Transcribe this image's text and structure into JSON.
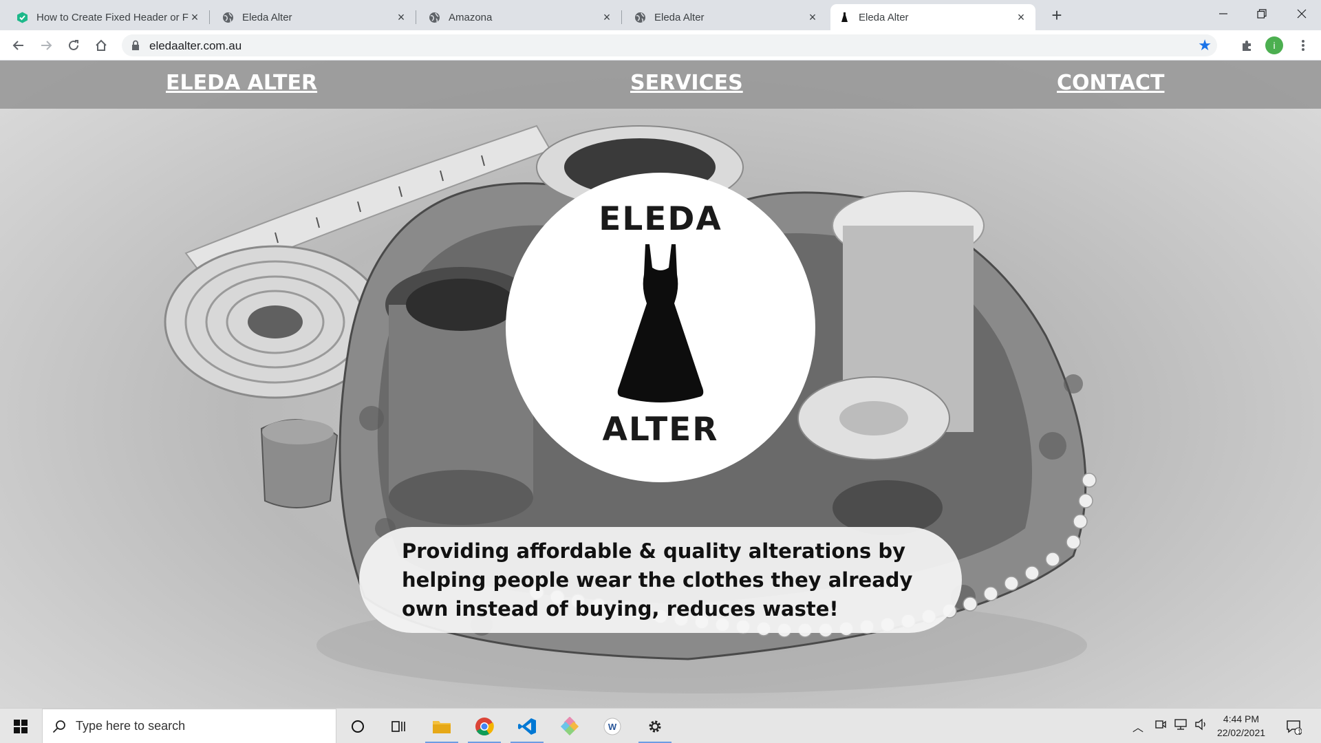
{
  "browser": {
    "tabs": [
      {
        "title": "How to Create Fixed Header or F",
        "favicon": "green-hex-icon",
        "active": false
      },
      {
        "title": "Eleda Alter",
        "favicon": "globe-icon",
        "active": false
      },
      {
        "title": "Amazona",
        "favicon": "globe-icon",
        "active": false
      },
      {
        "title": "Eleda Alter",
        "favicon": "globe-icon",
        "active": false
      },
      {
        "title": "Eleda Alter",
        "favicon": "dress-icon",
        "active": true
      }
    ],
    "url": "eledaalter.com.au",
    "profile_initial": "i",
    "accent_color": "#1a73e8"
  },
  "site": {
    "nav": {
      "brand": "ELEDA ALTER",
      "services": "SERVICES",
      "contact": "CONTACT"
    },
    "logo": {
      "line1": "ELEDA",
      "line2": "ALTER"
    },
    "tagline": "Providing affordable & quality alterations by helping people wear the clothes they already own instead of buying, reduces waste!"
  },
  "taskbar": {
    "search_placeholder": "Type here to search",
    "time": "4:44 PM",
    "date": "22/02/2021",
    "notification_count": "1"
  }
}
